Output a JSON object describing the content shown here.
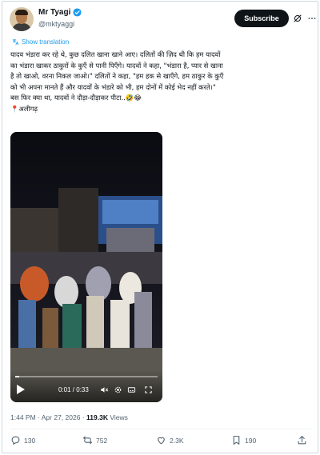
{
  "author": {
    "name": "Mr Tyagi",
    "handle": "@mktyaggi"
  },
  "subscribe_label": "Subscribe",
  "show_translation": "Show translation",
  "tweet": {
    "text": "यादव भंडारा कर रहे थे, कुछ दलित खाना खाने आए। दलितों की ज़िद थी कि हम यादवों\nका भंडारा खाकर ठाकुरों के कुएँ से पानी पिएँगे। यादवों ने कहा, \"भंडारा है, प्यार से खाना\nहै तो खाओ, वरना निकल जाओ।\" दलितों ने कहा, \"हम हक से खाएँगे, हम ठाकुर के कुएँ\nको भी अपना मानते हैं और यादवों के भंडारे को भी, हम दोनों में कोई भेद नहीं करते।\"\nबस फिर क्या था, यादवों ने दौड़ा-दौड़ाकर पीटा..🤣😂\n📍अलीगढ़"
  },
  "video": {
    "time": "0:01 / 0:33",
    "progress": 0.03
  },
  "meta": {
    "time": "1:44 PM",
    "date": "Apr 27, 2026",
    "views_count": "119.3K",
    "views_label": "Views"
  },
  "actions": {
    "replies": "130",
    "reposts": "752",
    "likes": "2.3K",
    "bookmarks": "190"
  },
  "colors": {
    "accent": "#1d9bf0",
    "text": "#0f1419",
    "muted": "#536471",
    "repost": "#00ba7c"
  }
}
